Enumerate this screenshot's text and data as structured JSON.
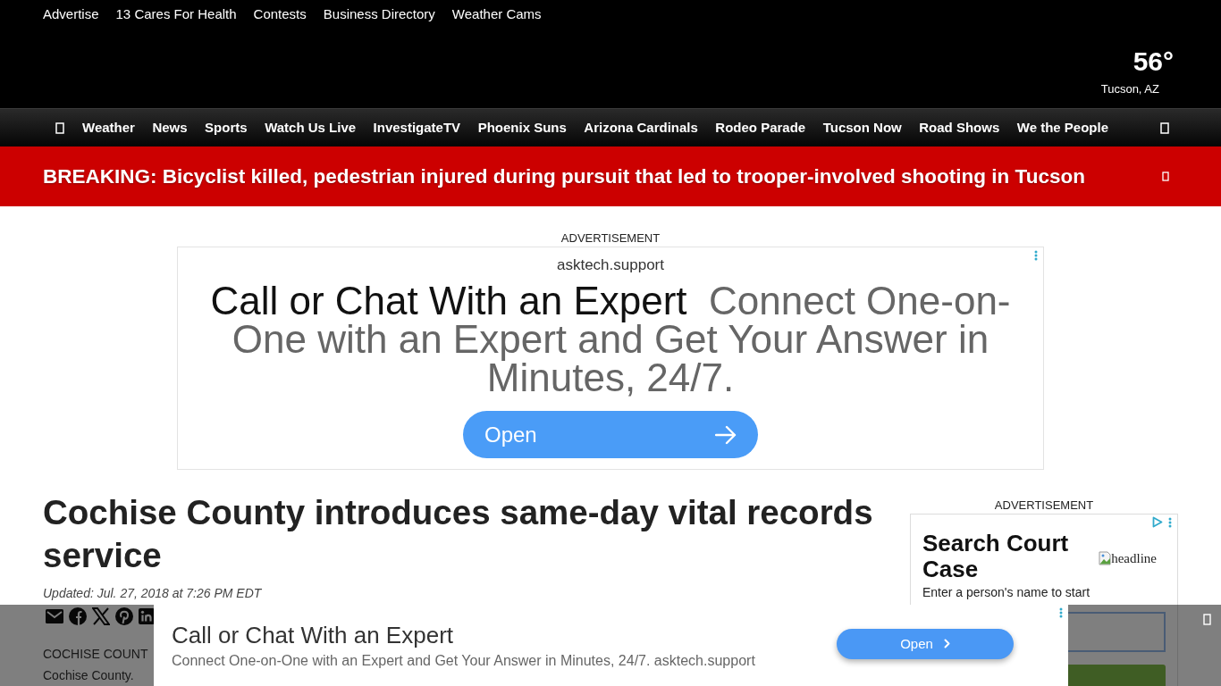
{
  "top_links": [
    "Advertise",
    "13 Cares For Health",
    "Contests",
    "Business Directory",
    "Weather Cams"
  ],
  "weather": {
    "temperature": "56°",
    "location": "Tucson, AZ"
  },
  "nav": {
    "items": [
      "Weather",
      "News",
      "Sports",
      "Watch Us Live",
      "InvestigateTV",
      "Phoenix Suns",
      "Arizona Cardinals",
      "Rodeo Parade",
      "Tucson Now",
      "Road Shows",
      "We the People"
    ]
  },
  "breaking_banner": {
    "text": "BREAKING: Bicyclist killed, pedestrian injured during pursuit that led to trooper-involved shooting in Tucson"
  },
  "top_ad": {
    "label": "ADVERTISEMENT",
    "domain": "asktech.support",
    "headline": "Call or Chat With an Expert",
    "description": "Connect One-on-One with an Expert and Get Your Answer in Minutes, 24/7.",
    "button": "Open"
  },
  "article": {
    "headline": "Cochise County introduces same-day vital records service",
    "updated": "Updated: Jul. 27, 2018 at 7:26 PM EDT",
    "body_lines": [
      "COCHISE COUNT",
      "Cochise County."
    ]
  },
  "sidebar_ad": {
    "label": "ADVERTISEMENT",
    "headline": "Search Court Case",
    "image_alt": "headline",
    "prompt": "Enter a person's name to start"
  },
  "bottom_ad": {
    "headline": "Call or Chat With an Expert",
    "description": "Connect One-on-One with an Expert and Get Your Answer in Minutes, 24/7. asktech.support",
    "button": "Open"
  }
}
